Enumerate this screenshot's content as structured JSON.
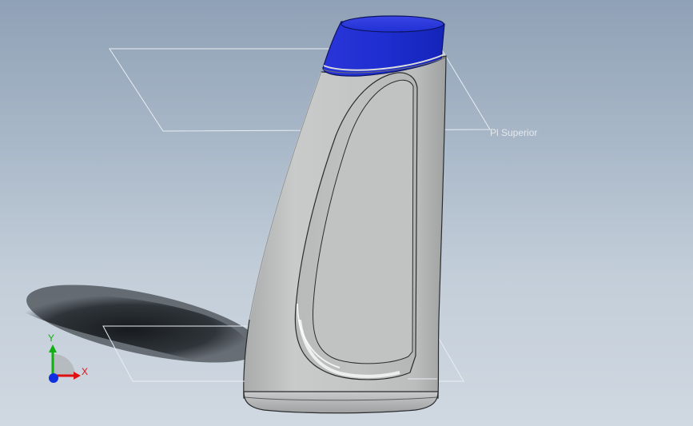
{
  "viewport": {
    "background_top": "#8fa1b6",
    "background_bottom": "#d0d8e1"
  },
  "planes": {
    "top_plane_label": "Pl Superior"
  },
  "model": {
    "cap_color": "#1f2fd0",
    "body_color": "#c2c4c4"
  },
  "triad": {
    "x_label": "X",
    "y_label": "Y",
    "x_color": "#e01010",
    "y_color": "#10b010",
    "z_color": "#1030e0"
  }
}
